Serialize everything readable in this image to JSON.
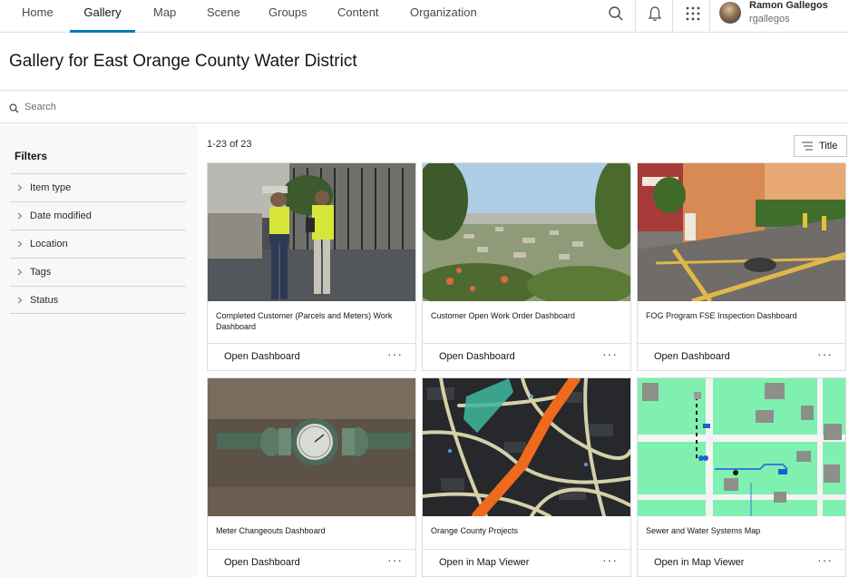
{
  "nav": {
    "tabs": [
      {
        "label": "Home",
        "active": false
      },
      {
        "label": "Gallery",
        "active": true
      },
      {
        "label": "Map",
        "active": false
      },
      {
        "label": "Scene",
        "active": false
      },
      {
        "label": "Groups",
        "active": false
      },
      {
        "label": "Content",
        "active": false
      },
      {
        "label": "Organization",
        "active": false
      }
    ],
    "icons": [
      "search-icon",
      "bell-icon",
      "app-launcher-icon"
    ],
    "user": {
      "name": "Ramon Gallegos",
      "username": "rgallegos"
    }
  },
  "page": {
    "title": "Gallery for East Orange County Water District"
  },
  "search": {
    "placeholder": "Search",
    "value": ""
  },
  "filters": {
    "title": "Filters",
    "items": [
      {
        "label": "Item type"
      },
      {
        "label": "Date modified"
      },
      {
        "label": "Location"
      },
      {
        "label": "Tags"
      },
      {
        "label": "Status"
      }
    ]
  },
  "results": {
    "count_label": "1-23 of 23",
    "sort_label": "Title"
  },
  "cards": [
    {
      "title": "Completed Customer (Parcels and Meters) Work Dashboard",
      "action": "Open Dashboard",
      "thumbnail": "field-workers-photo"
    },
    {
      "title": "Customer Open Work Order Dashboard",
      "action": "Open Dashboard",
      "thumbnail": "city-view-photo"
    },
    {
      "title": "FOG Program FSE Inspection Dashboard",
      "action": "Open Dashboard",
      "thumbnail": "restaurant-exterior-photo"
    },
    {
      "title": "Meter Changeouts Dashboard",
      "action": "Open Dashboard",
      "thumbnail": "water-meter-photo"
    },
    {
      "title": "Orange County Projects",
      "action": "Open in Map Viewer",
      "thumbnail": "dark-street-map"
    },
    {
      "title": "Sewer and Water Systems Map",
      "action": "Open in Map Viewer",
      "thumbnail": "green-parcel-map"
    }
  ],
  "colors": {
    "accent": "#007ac2",
    "sidebar_bg": "#f8f8f8",
    "border": "#e0e0e0"
  }
}
